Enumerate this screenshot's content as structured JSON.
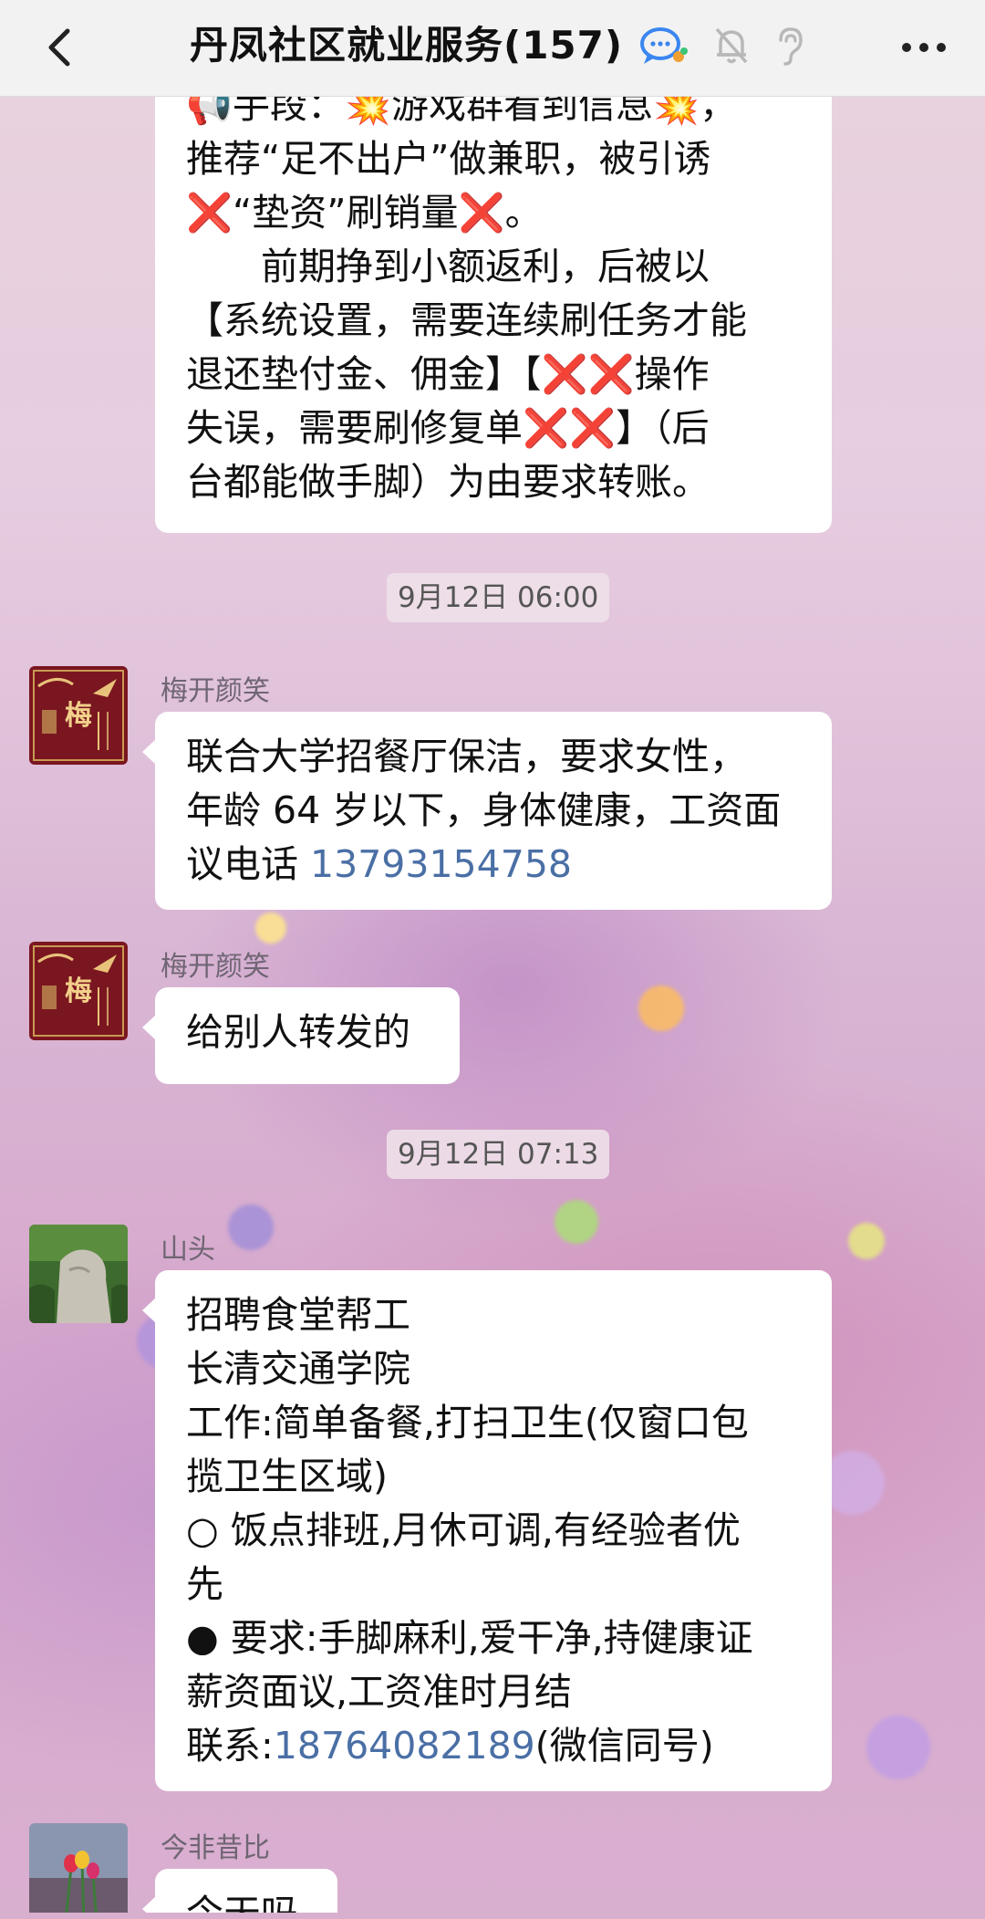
{
  "header": {
    "title": "丹凤社区就业服务(157)",
    "icons": [
      "back-icon",
      "chat-bubble-icon",
      "mute-bell-icon",
      "ear-icon",
      "more-icon"
    ]
  },
  "messages": [
    {
      "partial": true,
      "lines": [
        "📢手段：💥游戏群看到信息💥，",
        "推荐“足不出户”做兼职，被引诱",
        "❌“垫资”刷销量❌。",
        "　　前期挣到小额返利，后被以",
        "【系统设置，需要连续刷任务才能",
        "退还垫付金、佣金】【❌❌操作",
        "失误，需要刷修复单❌❌】（后",
        "台都能做手脚）为由要求转账。"
      ]
    },
    {
      "time": "9月12日 06:00"
    },
    {
      "sender": "梅开颜笑",
      "avatar": "mei-avatar",
      "lines": [
        "联合大学招餐厅保洁，要求女性，",
        "年龄 64 岁以下，身体健康，工资面"
      ],
      "line_prefix": "议电话 ",
      "phone": "13793154758"
    },
    {
      "sender": "梅开颜笑",
      "avatar": "mei-avatar",
      "lines": [
        "给别人转发的"
      ]
    },
    {
      "time": "9月12日 07:13"
    },
    {
      "sender": "山头",
      "avatar": "rock-avatar",
      "lines": [
        "招聘食堂帮工",
        "长清交通学院",
        "工作:简单备餐,打扫卫生(仅窗口包",
        "揽卫生区域)",
        "○ 饭点排班,月休可调,有经验者优",
        "先",
        "● 要求:手脚麻利,爱干净,持健康证",
        "薪资面议,工资准时月结"
      ],
      "contact_prefix": "联系:",
      "phone": "18764082189",
      "contact_suffix": "(微信同号)"
    },
    {
      "sender": "今非昔比",
      "avatar": "flower-avatar",
      "lines": [
        "今天吗"
      ]
    }
  ],
  "colors": {
    "phone_link": "#4a6fa5",
    "bubble": "#ffffff",
    "header_bg": "#f2f2f2"
  }
}
